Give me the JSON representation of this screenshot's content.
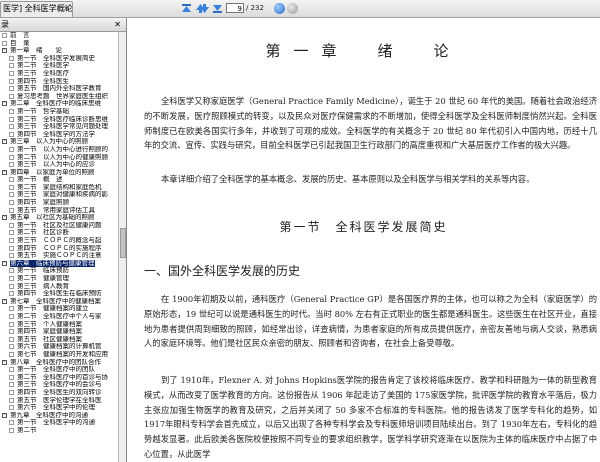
{
  "tab": {
    "title": "医学] 全科医学概论文字版"
  },
  "nav": {
    "current_page": "9",
    "total_pages": "/ 232"
  },
  "sidebar": {
    "title": "录",
    "items": [
      {
        "level": 1,
        "exp": "",
        "text": "前　言"
      },
      {
        "level": 1,
        "exp": "",
        "text": "目　录"
      },
      {
        "level": 1,
        "exp": "-",
        "text": "第一章　绪　　论"
      },
      {
        "level": 2,
        "exp": "",
        "text": "第一节　全科医学发展简史"
      },
      {
        "level": 2,
        "exp": "",
        "text": "第二节　全科医学"
      },
      {
        "level": 2,
        "exp": "",
        "text": "第三节　全科医疗"
      },
      {
        "level": 2,
        "exp": "",
        "text": "第四节　全科医生"
      },
      {
        "level": 2,
        "exp": "",
        "text": "第五节　国内外全科医学教育"
      },
      {
        "level": 2,
        "exp": "",
        "text": "复习思考题　世界家庭医生组织"
      },
      {
        "level": 1,
        "exp": "-",
        "text": "第二章　全科医疗中的临床思维"
      },
      {
        "level": 2,
        "exp": "",
        "text": "第一节　哲学基础"
      },
      {
        "level": 2,
        "exp": "",
        "text": "第二节　全科医疗临床诊断思维"
      },
      {
        "level": 2,
        "exp": "",
        "text": "第三节　全科医学常见问题处理"
      },
      {
        "level": 2,
        "exp": "",
        "text": "第四节　全科医学的方法学"
      },
      {
        "level": 1,
        "exp": "-",
        "text": "第三章　以人为中心的照顾"
      },
      {
        "level": 2,
        "exp": "",
        "text": "第一节　以人为中心进行照顾的"
      },
      {
        "level": 2,
        "exp": "",
        "text": "第二节　以人为中心的健康照顾"
      },
      {
        "level": 2,
        "exp": "",
        "text": "第三节　以人为中心的应诊"
      },
      {
        "level": 1,
        "exp": "-",
        "text": "第四章　以家庭为单位的照顾"
      },
      {
        "level": 2,
        "exp": "",
        "text": "第一节　概　述"
      },
      {
        "level": 2,
        "exp": "",
        "text": "第二节　家庭结构和家庭危机"
      },
      {
        "level": 2,
        "exp": "",
        "text": "第三节　家庭对健康和疾病的影"
      },
      {
        "level": 2,
        "exp": "",
        "text": "第四节　家庭照顾"
      },
      {
        "level": 2,
        "exp": "",
        "text": "第五节　常用家庭评估工具"
      },
      {
        "level": 1,
        "exp": "-",
        "text": "第五章　以社区为基础的照顾"
      },
      {
        "level": 2,
        "exp": "",
        "text": "第一节　社区及社区健康问题"
      },
      {
        "level": 2,
        "exp": "",
        "text": "第二节　社区诊断"
      },
      {
        "level": 2,
        "exp": "",
        "text": "第三节　ＣＯＰＣ的概念与起"
      },
      {
        "level": 2,
        "exp": "",
        "text": "第四节　ＣＯＰＣ的实施程序"
      },
      {
        "level": 2,
        "exp": "",
        "text": "第五节　实施ＣＯＰＣ的注意"
      },
      {
        "level": 1,
        "exp": "-",
        "text": "第六章　临床预防与健康管理",
        "selected": true
      },
      {
        "level": 2,
        "exp": "",
        "text": "第一节　临床预防"
      },
      {
        "level": 2,
        "exp": "",
        "text": "第二节　健康管理"
      },
      {
        "level": 2,
        "exp": "",
        "text": "第三节　病人教育"
      },
      {
        "level": 2,
        "exp": "",
        "text": "第四节　全科医生在临床预防"
      },
      {
        "level": 1,
        "exp": "-",
        "text": "第七章　全科医疗中的健康档案"
      },
      {
        "level": 2,
        "exp": "",
        "text": "第一节　健康档案的建立"
      },
      {
        "level": 2,
        "exp": "",
        "text": "第二节　全科医疗中个人与家"
      },
      {
        "level": 2,
        "exp": "",
        "text": "第三节　个人健康档案"
      },
      {
        "level": 2,
        "exp": "",
        "text": "第四节　家庭健康档案"
      },
      {
        "level": 2,
        "exp": "",
        "text": "第五节　社区健康档案"
      },
      {
        "level": 2,
        "exp": "",
        "text": "第六节　健康档案的计算机管"
      },
      {
        "level": 2,
        "exp": "",
        "text": "第七节　健康档案的开发和应用"
      },
      {
        "level": 1,
        "exp": "-",
        "text": "第八章　全科医疗中的团队合作"
      },
      {
        "level": 2,
        "exp": "",
        "text": "第一节　全科医疗中的团队"
      },
      {
        "level": 2,
        "exp": "",
        "text": "第二节　全科医疗中的首诊与协"
      },
      {
        "level": 2,
        "exp": "",
        "text": "第三节　全科医疗中的会诊与"
      },
      {
        "level": 2,
        "exp": "",
        "text": "第四节　全科医生的双向转诊"
      },
      {
        "level": 2,
        "exp": "",
        "text": "第五节　医学伦理学在全科医"
      },
      {
        "level": 2,
        "exp": "",
        "text": "第六节　全科医学中的伦理"
      },
      {
        "level": 1,
        "exp": "-",
        "text": "第九章　全科医疗中的沟通"
      },
      {
        "level": 2,
        "exp": "",
        "text": "第一节　全科医学中的沟通"
      },
      {
        "level": 2,
        "exp": "",
        "text": "第二节　"
      }
    ]
  },
  "doc": {
    "chapter_title": "第一章　绪　论",
    "p1": "全科医学又称家庭医学（General Practice Family Medicine），诞生于 20 世纪 60 年代的美国。随着社会政治经济的不断发展，医疗照顾模式的转变，以及民众对医疗保健需求的不断增加，使得全科医学及全科医师制度悄然兴起。全科医师制度已在欧美各国实行多年，并收到了可观的成效。全科医学的有关概念于 20 世纪 80 年代初引入中国内地，历经十几年的交流、宣传、实践与研究，目前全科医学已引起我国卫生行政部门的高度重视和广大基层医疗工作者的极大兴趣。",
    "p2": "本章详细介绍了全科医学的基本概念、发展的历史、基本原则以及全科医学与相关学科的关系等内容。",
    "section_title": "第一节　全科医学发展简史",
    "subsection_title": "一、国外全科医学发展的历史",
    "p3": "在 1900年初期及以前，通科医疗（General Practice GP）是各国医疗界的主体，也可以称之为全科（家庭医学）的原始形态，19 世纪可以说是通科医生的时代。当时 80% 左右有正式职业的医生都是通科医生。这些医生在社区开业，直接地为患者提供周到细致的照顾，如经常出诊，详查病情，为患者家庭的所有成员提供医疗，亲密友善地与病人交谈，熟悉病人的家庭环境等。他们是社区民众亲密的朋友、照顾者和咨询者，在社会上备受尊敬。",
    "p4": "到了 1910年，Flexner A. 对 Johns Hopkins医学院的报告肯定了该校将临床医疗、教学和科研融为一体的新型教育模式，从而改变了医学教育的方向。这份报告从 1906 年起走访了美国的 175家医学院，批评医学院的教育水平落后，极力主张应加强生物医学的教育及研究，之后并关闭了 50 多家不合标准的专科医院。他的报告诱发了医学专科化的趋势，如 1917年眼科专科学会首先成立，以后又出现了各种专科学会及专科医师培训项目陆续出台。到了 1930年左右，专科化的趋势越发显著。此后欧美各医院校便按照不同专业的要求组织教学，医学科学研究逐渐在以医院为主体的临床医疗中占据了中心位置，从此医学"
  }
}
